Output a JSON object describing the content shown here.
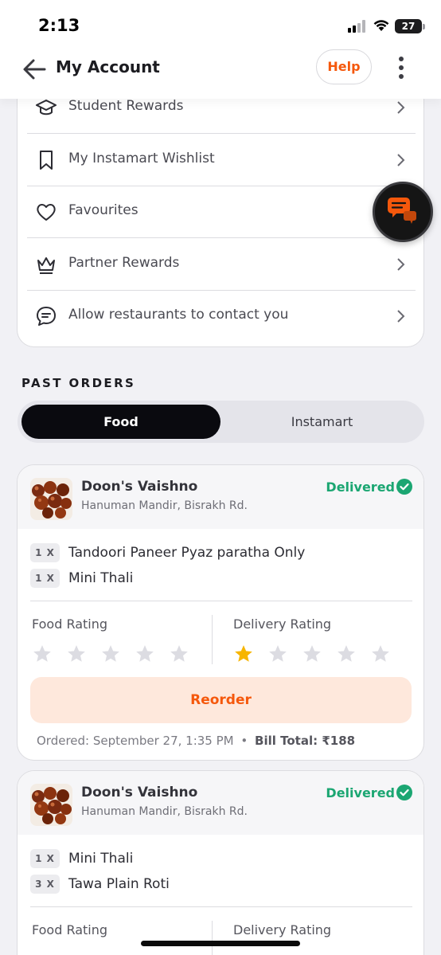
{
  "status_bar": {
    "time": "2:13",
    "battery": "27"
  },
  "header": {
    "title": "My Account",
    "help_label": "Help"
  },
  "menu": {
    "items": [
      {
        "label": "Student Rewards",
        "icon": "graduation-cap-icon"
      },
      {
        "label": "My Instamart Wishlist",
        "icon": "bookmark-icon"
      },
      {
        "label": "Favourites",
        "icon": "heart-icon"
      },
      {
        "label": "Partner Rewards",
        "icon": "crown-icon"
      },
      {
        "label": "Allow restaurants to contact you",
        "icon": "chat-icon"
      }
    ]
  },
  "past_orders": {
    "title": "PAST ORDERS",
    "tabs": [
      {
        "label": "Food",
        "selected": true
      },
      {
        "label": "Instamart",
        "selected": false
      }
    ],
    "orders": [
      {
        "restaurant": "Doon's Vaishno",
        "address": "Hanuman Mandir, Bisrakh Rd.",
        "status": "Delivered",
        "items": [
          {
            "qty": "1 X",
            "name": "Tandoori Paneer Pyaz paratha Only"
          },
          {
            "qty": "1 X",
            "name": "Mini Thali"
          }
        ],
        "food_rating_label": "Food Rating",
        "delivery_rating_label": "Delivery Rating",
        "food_rating": 0,
        "delivery_rating": 1,
        "reorder_label": "Reorder",
        "ordered_text": "Ordered: September 27, 1:35 PM",
        "separator": "•",
        "bill_text": "Bill Total: ₹188"
      },
      {
        "restaurant": "Doon's Vaishno",
        "address": "Hanuman Mandir, Bisrakh Rd.",
        "status": "Delivered",
        "items": [
          {
            "qty": "1 X",
            "name": "Mini Thali"
          },
          {
            "qty": "3 X",
            "name": "Tawa Plain Roti"
          }
        ],
        "food_rating_label": "Food Rating",
        "delivery_rating_label": "Delivery Rating"
      }
    ]
  },
  "colors": {
    "accent": "#f5580c",
    "delivered": "#1ba672",
    "star_filled": "#f7b500",
    "star_empty": "#dcdce2"
  }
}
